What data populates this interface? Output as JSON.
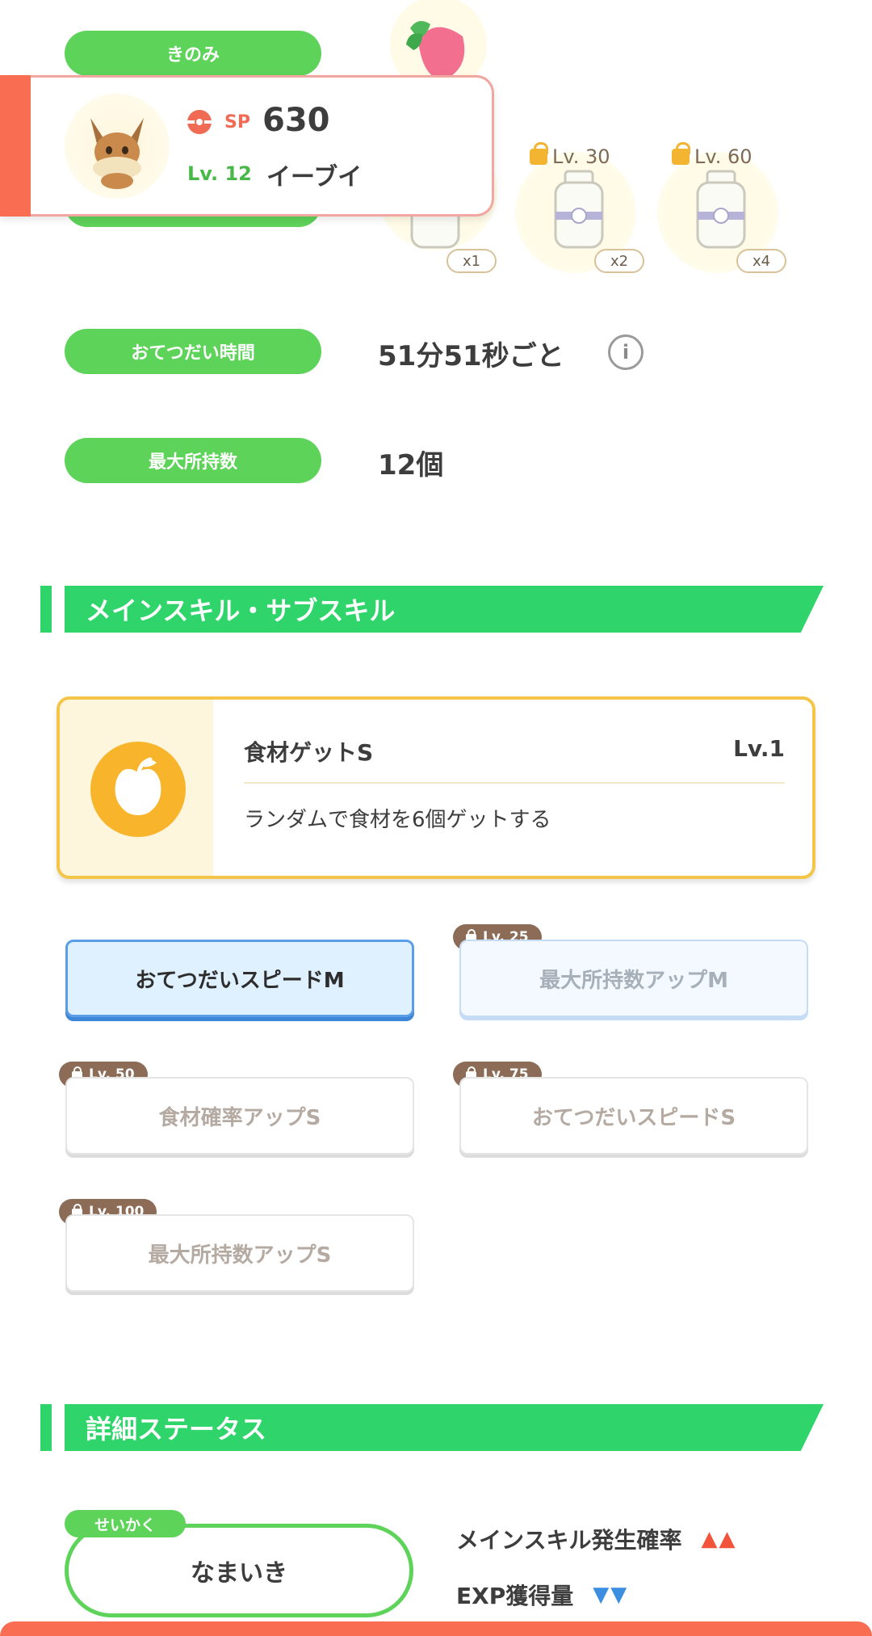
{
  "colors": {
    "green": "#5ed35a",
    "section_green": "#2fd56a",
    "accent_red": "#f96d53",
    "gold": "#f3c548",
    "brown_tag": "#8c6c57"
  },
  "top": {
    "berry_label": "きのみ",
    "slots": [
      {
        "multiplier": "x1"
      },
      {
        "lock_level": "Lv. 30",
        "multiplier": "x2"
      },
      {
        "lock_level": "Lv. 60",
        "multiplier": "x4"
      }
    ]
  },
  "summary": {
    "sp_tag": "SP",
    "sp_value": "630",
    "level": "Lv. 12",
    "name": "イーブイ"
  },
  "help_time": {
    "label": "おてつだい時間",
    "value": "51分51秒ごと",
    "info_icon": "i"
  },
  "max_carry": {
    "label": "最大所持数",
    "value": "12個"
  },
  "section_skills": {
    "title": "メインスキル・サブスキル"
  },
  "main_skill": {
    "name": "食材ゲットS",
    "level": "Lv.1",
    "description": "ランダムで食材を6個ゲットする",
    "icon": "apple-icon"
  },
  "sub_skills": [
    {
      "label": "おてつだいスピードM"
    },
    {
      "label": "最大所持数アップM",
      "lock": "Lv. 25"
    },
    {
      "label": "食材確率アップS",
      "lock": "Lv. 50"
    },
    {
      "label": "おてつだいスピードS",
      "lock": "Lv. 75"
    },
    {
      "label": "最大所持数アップS",
      "lock": "Lv. 100"
    }
  ],
  "section_details": {
    "title": "詳細ステータス"
  },
  "nature": {
    "tag": "せいかく",
    "value": "なまいき"
  },
  "effects": [
    {
      "label": "メインスキル発生確率",
      "arrows": "▲▲"
    },
    {
      "label": "EXP獲得量",
      "arrows": "▼▼"
    }
  ]
}
